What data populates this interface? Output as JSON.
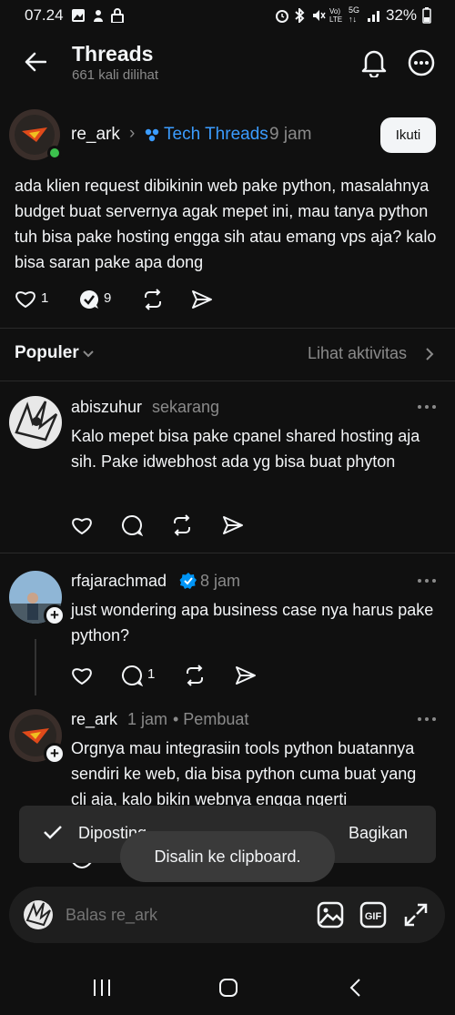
{
  "status": {
    "time": "07.24",
    "battery": "32%"
  },
  "header": {
    "title": "Threads",
    "views": "661 kali dilihat"
  },
  "post": {
    "author": "re_ark",
    "community": "Tech Threads",
    "time": "9 jam",
    "follow_label": "Ikuti",
    "text": "ada klien request dibikinin web pake python, masalahnya budget buat servernya agak mepet ini, mau tanya python tuh bisa pake hosting engga sih atau emang vps aja? kalo bisa saran pake apa dong",
    "likes": "1",
    "comments": "9"
  },
  "sort": {
    "label": "Populer",
    "activity": "Lihat aktivitas"
  },
  "replies": [
    {
      "author": "abiszuhur",
      "time": "sekarang",
      "text": "Kalo mepet bisa pake cpanel shared hosting aja sih. Pake idwebhost ada yg bisa buat phyton"
    },
    {
      "author": "rfajarachmad",
      "time": "8 jam",
      "text": "just wondering apa business case nya harus pake python?",
      "comments": "1"
    },
    {
      "author": "re_ark",
      "time": "1 jam",
      "creator": "• Pembuat",
      "text": "Orgnya mau integrasiin tools python buatannya sendiri ke web, dia bisa python cuma buat yang cli aja, kalo bikin webnya engga ngerti"
    }
  ],
  "snackbar": {
    "label": "Diposting",
    "action": "Bagikan"
  },
  "toast": "Disalin ke clipboard.",
  "reply_bar": {
    "placeholder": "Balas re_ark"
  },
  "colors": {
    "background": "#101010",
    "accent": "#3b9cff",
    "verified": "#0095f6",
    "online": "#3cc14d"
  }
}
